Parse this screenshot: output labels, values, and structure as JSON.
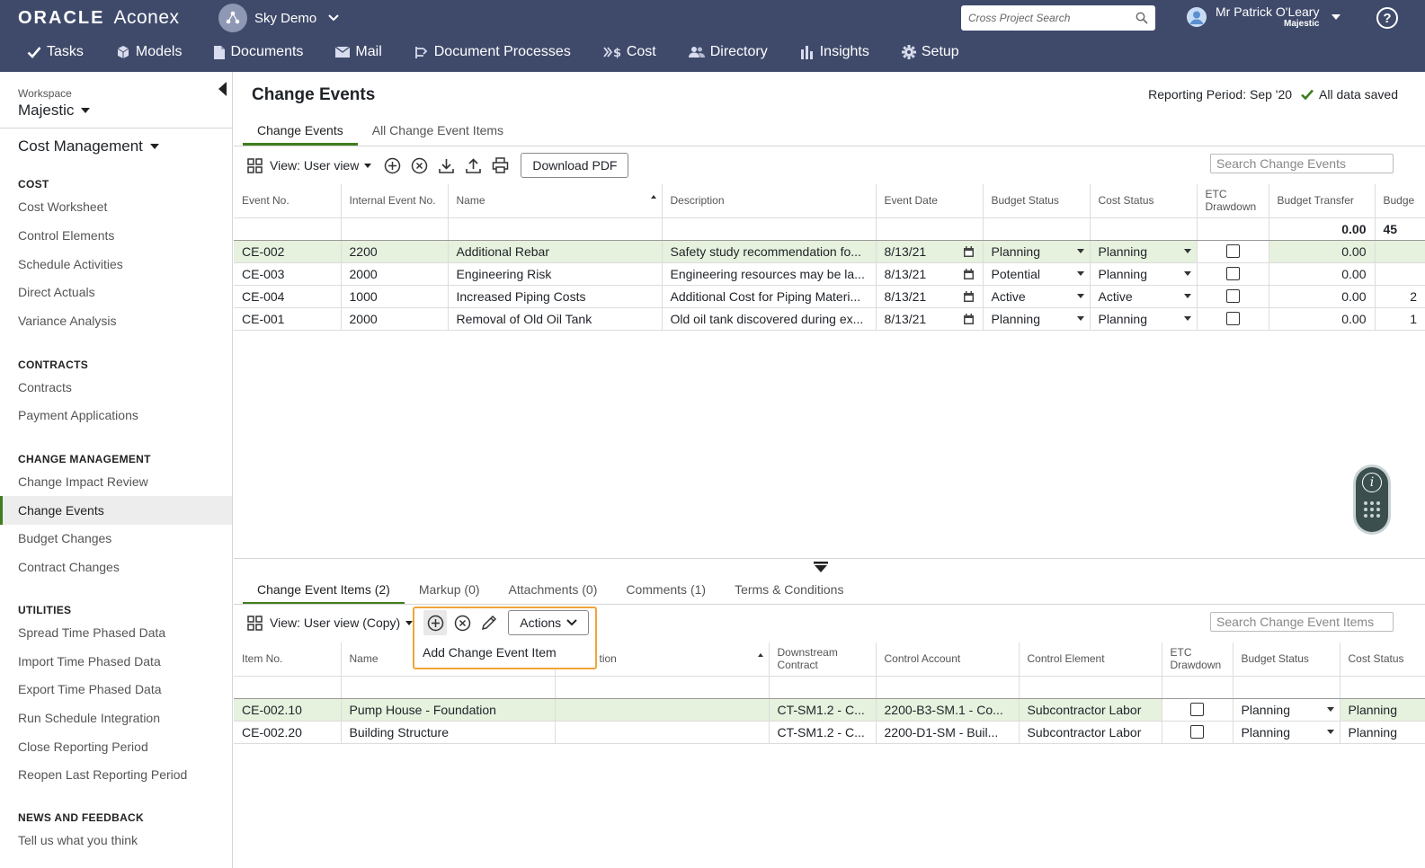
{
  "brand": {
    "oracle": "ORACLE",
    "aconex": "Aconex"
  },
  "project": {
    "name": "Sky Demo"
  },
  "cross_search": {
    "placeholder": "Cross Project Search"
  },
  "user": {
    "name": "Mr Patrick O'Leary",
    "workspace": "Majestic"
  },
  "help_label": "?",
  "nav": [
    {
      "label": "Tasks",
      "icon": "check-icon"
    },
    {
      "label": "Models",
      "icon": "cube-icon"
    },
    {
      "label": "Documents",
      "icon": "document-icon"
    },
    {
      "label": "Mail",
      "icon": "mail-icon"
    },
    {
      "label": "Document Processes",
      "icon": "process-icon"
    },
    {
      "label": "Cost",
      "icon": "cost-icon"
    },
    {
      "label": "Directory",
      "icon": "people-icon"
    },
    {
      "label": "Insights",
      "icon": "bar-chart-icon"
    },
    {
      "label": "Setup",
      "icon": "gear-icon"
    }
  ],
  "sidebar": {
    "workspace_label": "Workspace",
    "workspace_name": "Majestic",
    "module": "Cost Management",
    "sections": [
      {
        "title": "COST",
        "items": [
          "Cost Worksheet",
          "Control Elements",
          "Schedule Activities",
          "Direct Actuals",
          "Variance Analysis"
        ]
      },
      {
        "title": "CONTRACTS",
        "items": [
          "Contracts",
          "Payment Applications"
        ]
      },
      {
        "title": "CHANGE MANAGEMENT",
        "items": [
          "Change Impact Review",
          "Change Events",
          "Budget Changes",
          "Contract Changes"
        ]
      },
      {
        "title": "UTILITIES",
        "items": [
          "Spread Time Phased Data",
          "Import Time Phased Data",
          "Export Time Phased Data",
          "Run Schedule Integration",
          "Close Reporting Period",
          "Reopen Last Reporting Period"
        ]
      },
      {
        "title": "NEWS AND FEEDBACK",
        "items": [
          "Tell us what you think"
        ]
      }
    ],
    "active_item": "Change Events"
  },
  "page": {
    "title": "Change Events",
    "reporting_period": "Reporting Period: Sep '20",
    "save_status": "All data saved",
    "tabs": [
      "Change Events",
      "All Change Event Items"
    ],
    "active_tab": 0
  },
  "top_toolbar": {
    "view": "View: User view",
    "download_pdf": "Download PDF",
    "search_placeholder": "Search Change Events"
  },
  "events_table": {
    "columns": [
      "Event No.",
      "Internal Event No.",
      "Name",
      "Description",
      "Event Date",
      "Budget Status",
      "Cost Status",
      "ETC Drawdown",
      "Budget Transfer",
      "Budge"
    ],
    "totals": {
      "budget_transfer": "0.00",
      "next": "45"
    },
    "rows": [
      {
        "event_no": "CE-002",
        "internal": "2200",
        "name": "Additional Rebar",
        "description": "Safety study recommendation fo...",
        "date": "8/13/21",
        "budget_status": "Planning",
        "cost_status": "Planning",
        "budget_transfer": "0.00",
        "next": "",
        "selected": true
      },
      {
        "event_no": "CE-003",
        "internal": "2000",
        "name": "Engineering Risk",
        "description": "Engineering resources may be la...",
        "date": "8/13/21",
        "budget_status": "Potential",
        "cost_status": "Planning",
        "budget_transfer": "0.00",
        "next": "",
        "selected": false
      },
      {
        "event_no": "CE-004",
        "internal": "1000",
        "name": "Increased Piping Costs",
        "description": "Additional Cost for Piping Materi...",
        "date": "8/13/21",
        "budget_status": "Active",
        "cost_status": "Active",
        "budget_transfer": "0.00",
        "next": "2",
        "selected": false
      },
      {
        "event_no": "CE-001",
        "internal": "2000",
        "name": "Removal of Old Oil Tank",
        "description": "Old oil tank discovered during ex...",
        "date": "8/13/21",
        "budget_status": "Planning",
        "cost_status": "Planning",
        "budget_transfer": "0.00",
        "next": "1",
        "selected": false
      }
    ]
  },
  "detail": {
    "tabs": [
      "Change Event Items (2)",
      "Markup (0)",
      "Attachments (0)",
      "Comments (1)",
      "Terms & Conditions"
    ],
    "active_tab": 0,
    "view": "View: User view (Copy)",
    "actions_label": "Actions",
    "search_placeholder": "Search Change Event Items",
    "menu_item": "Add Change Event Item"
  },
  "items_table": {
    "columns": [
      "Item No.",
      "Name",
      "tion",
      "Downstream Contract",
      "Control Account",
      "Control Element",
      "ETC Drawdown",
      "Budget Status",
      "Cost Status"
    ],
    "rows": [
      {
        "item_no": "CE-002.10",
        "name": "Pump House - Foundation",
        "desc": "",
        "contract": "CT-SM1.2 - C...",
        "account": "2200-B3-SM.1 - Co...",
        "element": "Subcontractor Labor",
        "budget_status": "Planning",
        "cost_status": "Planning",
        "selected": true
      },
      {
        "item_no": "CE-002.20",
        "name": "Building Structure",
        "desc": "",
        "contract": "CT-SM1.2 - C...",
        "account": "2200-D1-SM - Buil...",
        "element": "Subcontractor Labor",
        "budget_status": "Planning",
        "cost_status": "Planning",
        "selected": false
      }
    ]
  },
  "colors": {
    "topbar": "#3f4a6b",
    "accent_green": "#3f7d20",
    "selected_row": "#e6f1de",
    "highlight_orange": "#f0a53a"
  }
}
